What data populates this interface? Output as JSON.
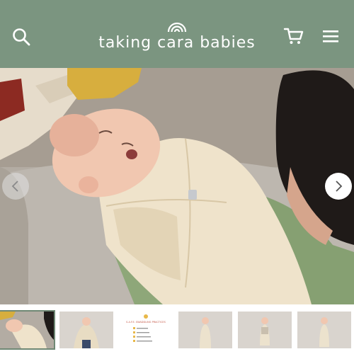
{
  "header": {
    "brand_name": "taking cara babies",
    "background_color": "#7b9580",
    "icons": [
      "search-icon",
      "rainbow-logo-icon",
      "cart-icon",
      "menu-icon"
    ]
  },
  "hero": {
    "prev_icon": "chevron-left-icon",
    "next_icon": "chevron-right-icon"
  },
  "thumbnails": {
    "count": 6,
    "active_index": 0,
    "chart_thumb_title": "S.A.F.E. SWADDLING PRACTICES"
  },
  "colors": {
    "accent": "#7b9580",
    "swaddle": "#efe2c8",
    "couch": "#b9b3ab"
  }
}
